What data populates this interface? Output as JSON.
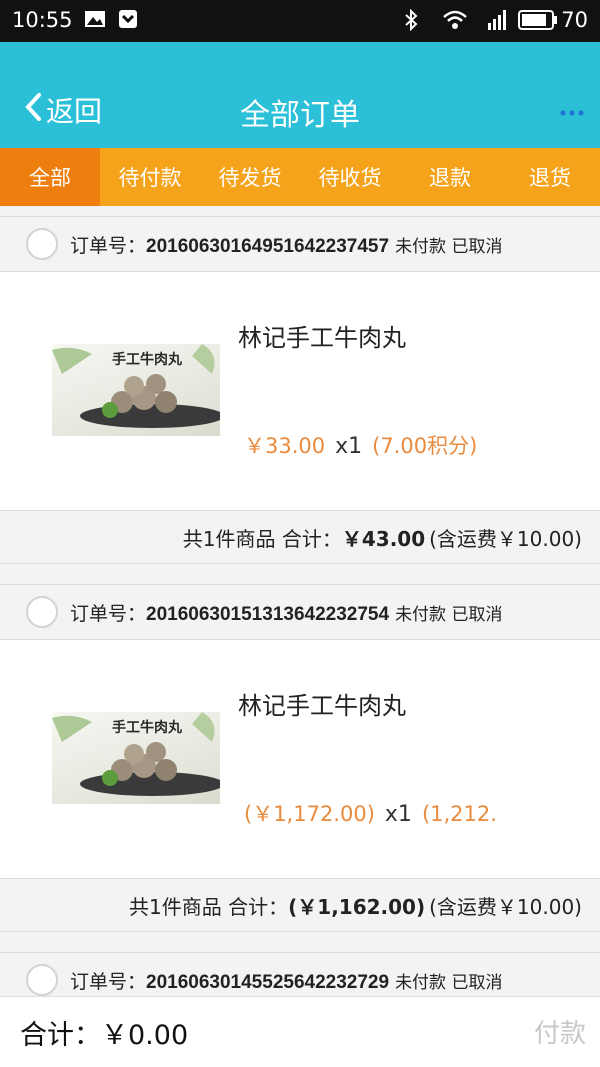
{
  "status_bar": {
    "time": "10:55",
    "battery": "70"
  },
  "header": {
    "back_label": "返回",
    "title": "全部订单"
  },
  "tabs": [
    {
      "label": "全部",
      "active": true
    },
    {
      "label": "待付款",
      "active": false
    },
    {
      "label": "待发货",
      "active": false
    },
    {
      "label": "待收货",
      "active": false
    },
    {
      "label": "退款",
      "active": false
    },
    {
      "label": "退货",
      "active": false
    }
  ],
  "orders": [
    {
      "order_no_label": "订单号：",
      "order_no": "20160630164951642237457",
      "status": "未付款 已取消",
      "product_name": "林记手工牛肉丸",
      "image_title": "手工牛肉丸",
      "price": "￥33.00",
      "qty": "x1",
      "points": "(7.00积分)",
      "summary_prefix": "共1件商品 合计：",
      "summary_total": "￥43.00",
      "summary_shipping": "(含运费￥10.00)"
    },
    {
      "order_no_label": "订单号：",
      "order_no": "20160630151313642232754",
      "status": "未付款 已取消",
      "product_name": "林记手工牛肉丸",
      "image_title": "手工牛肉丸",
      "price": "(￥1,172.00)",
      "qty": "x1",
      "points": "(1,212.",
      "summary_prefix": "共1件商品 合计：",
      "summary_total": "(￥1,162.00)",
      "summary_shipping": "(含运费￥10.00)"
    },
    {
      "order_no_label": "订单号：",
      "order_no": "20160630145525642232729",
      "status": "未付款 已取消"
    }
  ],
  "bottom": {
    "total_label": "合计：",
    "total_value": "￥0.00",
    "pay_label": "付款"
  },
  "colors": {
    "header_bg": "#2bbfd8",
    "tab_bg": "#f5a31a",
    "tab_active_bg": "#ee7f0f",
    "price": "#e98a3c"
  }
}
